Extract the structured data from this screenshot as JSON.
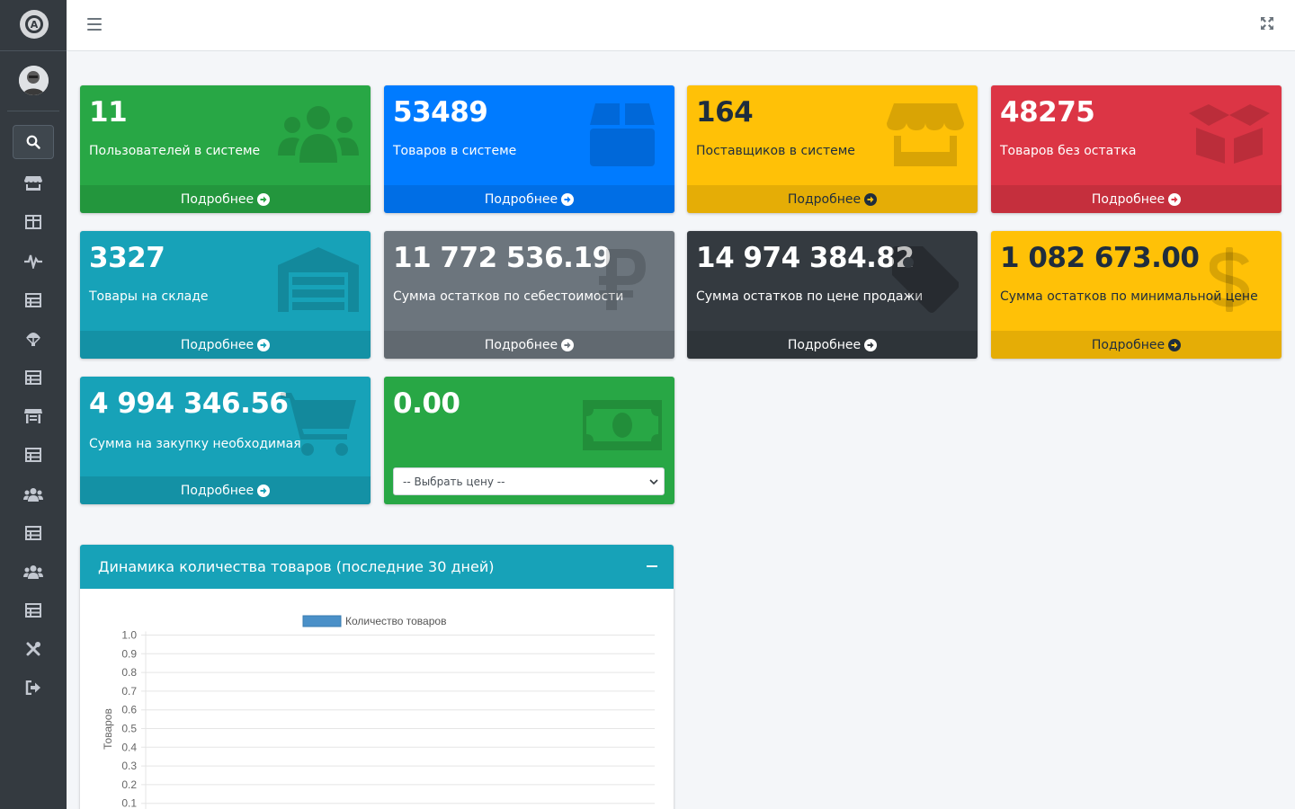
{
  "sidebar": {
    "logo_icon": "app-logo-icon",
    "avatar_icon": "user-avatar",
    "search_icon": "search-icon",
    "items": [
      {
        "icon": "store-icon"
      },
      {
        "icon": "table-icon"
      },
      {
        "icon": "heartbeat-icon"
      },
      {
        "icon": "table-icon"
      },
      {
        "icon": "parachute-icon"
      },
      {
        "icon": "table-icon"
      },
      {
        "icon": "warehouse-icon"
      },
      {
        "icon": "table-icon"
      },
      {
        "icon": "users-icon"
      },
      {
        "icon": "table-icon"
      },
      {
        "icon": "users-icon"
      },
      {
        "icon": "table-icon"
      },
      {
        "icon": "tools-icon"
      },
      {
        "icon": "sign-out-icon"
      }
    ]
  },
  "topbar": {
    "menu_icon": "hamburger-icon",
    "expand_icon": "expand-icon"
  },
  "boxes": [
    {
      "value": "11",
      "label": "Пользователей в системе",
      "more": "Подробнее",
      "color": "#28a745",
      "icon": "users-icon"
    },
    {
      "value": "53489",
      "label": "Товаров в системе",
      "more": "Подробнее",
      "color": "#007bff",
      "icon": "box-icon"
    },
    {
      "value": "164",
      "label": "Поставщиков в системе",
      "more": "Подробнее",
      "color": "#ffc107",
      "icon": "store-icon"
    },
    {
      "value": "48275",
      "label": "Товаров без остатка",
      "more": "Подробнее",
      "color": "#dc3545",
      "icon": "box-open-icon"
    },
    {
      "value": "3327",
      "label": "Товары на складе",
      "more": "Подробнее",
      "color": "#17a2b8",
      "icon": "warehouse-icon"
    },
    {
      "value": "11 772 536.19",
      "label": "Сумма остатков по себестоимости",
      "more": "Подробнее",
      "color": "#6c757d",
      "icon": "ruble-icon"
    },
    {
      "value": "14 974 384.82",
      "label": "Сумма остатков по цене продажи",
      "more": "Подробнее",
      "color": "#343a40",
      "icon": "tag-icon"
    },
    {
      "value": "1 082 673.00",
      "label": "Сумма остатков по минимальной цене",
      "more": "Подробнее",
      "color": "#ffc107",
      "icon": "dollar-icon"
    },
    {
      "value": "4 994 346.56",
      "label": "Сумма на закупку необходимая",
      "more": "Подробнее",
      "color": "#17a2b8",
      "icon": "cart-icon"
    },
    {
      "value": "0.00",
      "select_value": "-- Выбрать цену --",
      "color": "#28a745",
      "icon": "money-bill-icon"
    }
  ],
  "card": {
    "title": "Динамика количества товаров (последние 30 дней)",
    "collapse_icon": "minus-icon"
  },
  "chart_data": {
    "type": "bar",
    "legend": [
      "Количество товаров"
    ],
    "legend_position": "top",
    "ylabel": "Товаров",
    "ylim": [
      0,
      1.0
    ],
    "yticks": [
      "1.0",
      "0.9",
      "0.8",
      "0.7",
      "0.6",
      "0.5",
      "0.4",
      "0.3",
      "0.2",
      "0.1"
    ],
    "grid": true,
    "series": [
      {
        "name": "Количество товаров",
        "values": []
      }
    ],
    "series_color": "#4a90c8"
  }
}
